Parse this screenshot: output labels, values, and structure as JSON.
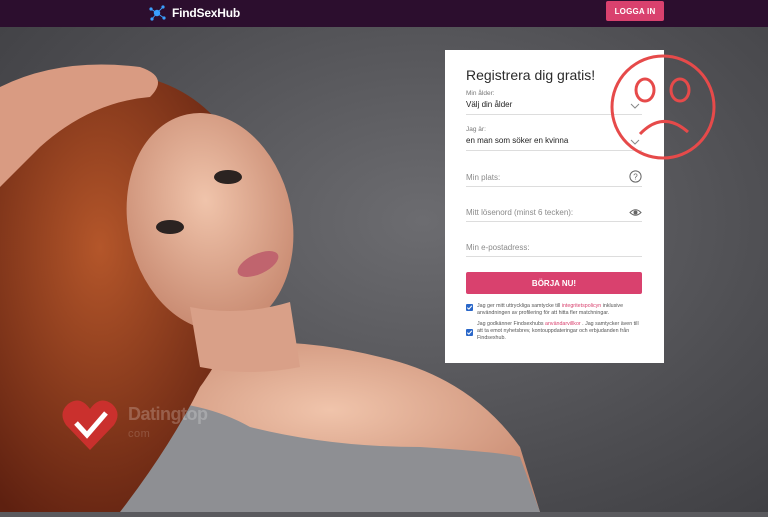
{
  "header": {
    "brand": "FindSexHub",
    "login_label": "LOGGA IN"
  },
  "signup": {
    "title": "Registrera dig gratis!",
    "age": {
      "label": "Min ålder:",
      "value": "Välj din ålder"
    },
    "seeking": {
      "label": "Jag är:",
      "value": "en man som söker en kvinna"
    },
    "location": {
      "placeholder": "Min plats:"
    },
    "password": {
      "placeholder": "Mitt lösenord (minst 6 tecken):"
    },
    "email": {
      "placeholder": "Min e-postadress:"
    },
    "submit_label": "BÖRJA NU!",
    "consent1": {
      "pre": "Jag ger mitt uttryckliga samtycke till ",
      "link": "integritetspolicyn",
      "post": " inklusive användningen av profilering för att hitta fler matchningar."
    },
    "consent2": {
      "pre": "Jag godkänner Findsexhubs ",
      "link": "användarvillkor",
      "post": " . Jag samtycker även till att ta emot nyhetsbrev, kontouppdateringar och erbjudanden från Findsexhub."
    }
  },
  "overlay": {
    "sad_face_color": "#e64a4a",
    "watermark_text": "Datingtop",
    "watermark_sub": "com"
  },
  "colors": {
    "topbar": "#2c0e2e",
    "accent": "#d9416e",
    "checkbox": "#2a67c9"
  },
  "icons": [
    "network-logo-icon",
    "chevron-down-icon",
    "question-circle-icon",
    "eye-icon",
    "checkbox-checked-icon",
    "sad-face-icon",
    "heart-check-icon"
  ]
}
